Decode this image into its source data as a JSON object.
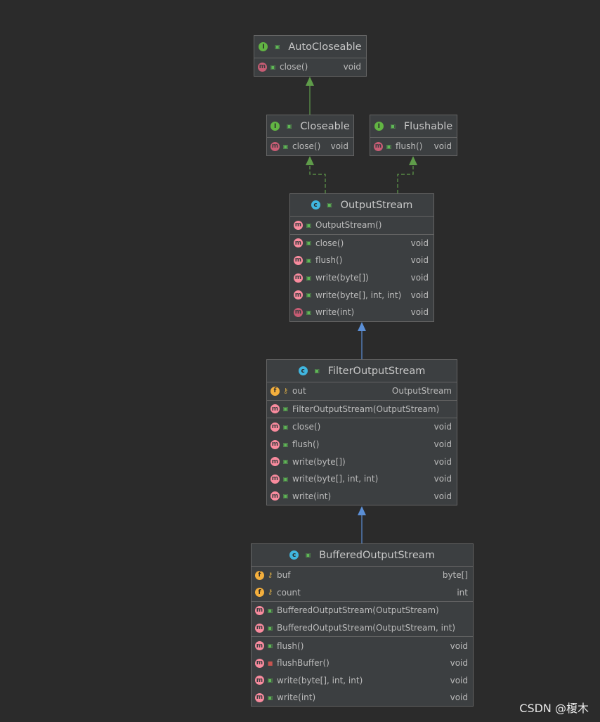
{
  "diagram": {
    "classes": {
      "auto_closeable": {
        "kind_icon": "interface-icon",
        "title": "AutoCloseable",
        "methods": [
          {
            "name": "close()",
            "type": "void",
            "abstract": true
          }
        ]
      },
      "closeable": {
        "kind_icon": "interface-icon",
        "title": "Closeable",
        "methods": [
          {
            "name": "close()",
            "type": "void",
            "abstract": true
          }
        ]
      },
      "flushable": {
        "kind_icon": "interface-icon",
        "title": "Flushable",
        "methods": [
          {
            "name": "flush()",
            "type": "void",
            "abstract": true
          }
        ]
      },
      "output_stream": {
        "kind_icon": "abstract-class-icon",
        "title": "OutputStream",
        "constructors": [
          {
            "name": "OutputStream()"
          }
        ],
        "methods": [
          {
            "name": "close()",
            "type": "void"
          },
          {
            "name": "flush()",
            "type": "void"
          },
          {
            "name": "write(byte[])",
            "type": "void"
          },
          {
            "name": "write(byte[], int, int)",
            "type": "void"
          },
          {
            "name": "write(int)",
            "type": "void",
            "abstract": true
          }
        ]
      },
      "filter_output_stream": {
        "kind_icon": "class-icon",
        "title": "FilterOutputStream",
        "fields": [
          {
            "name": "out",
            "type": "OutputStream",
            "visibility": "protected"
          }
        ],
        "constructors": [
          {
            "name": "FilterOutputStream(OutputStream)"
          }
        ],
        "methods": [
          {
            "name": "close()",
            "type": "void"
          },
          {
            "name": "flush()",
            "type": "void"
          },
          {
            "name": "write(byte[])",
            "type": "void"
          },
          {
            "name": "write(byte[], int, int)",
            "type": "void"
          },
          {
            "name": "write(int)",
            "type": "void"
          }
        ]
      },
      "buffered_output_stream": {
        "kind_icon": "class-icon",
        "title": "BufferedOutputStream",
        "fields": [
          {
            "name": "buf",
            "type": "byte[]",
            "visibility": "protected"
          },
          {
            "name": "count",
            "type": "int",
            "visibility": "protected"
          }
        ],
        "constructors": [
          {
            "name": "BufferedOutputStream(OutputStream)"
          },
          {
            "name": "BufferedOutputStream(OutputStream, int)"
          }
        ],
        "methods": [
          {
            "name": "flush()",
            "type": "void"
          },
          {
            "name": "flushBuffer()",
            "type": "void",
            "visibility": "private"
          },
          {
            "name": "write(byte[], int, int)",
            "type": "void"
          },
          {
            "name": "write(int)",
            "type": "void"
          }
        ]
      }
    },
    "relations": [
      {
        "from": "Closeable",
        "to": "AutoCloseable",
        "type": "extends"
      },
      {
        "from": "OutputStream",
        "to": "Closeable",
        "type": "implements"
      },
      {
        "from": "OutputStream",
        "to": "Flushable",
        "type": "implements"
      },
      {
        "from": "FilterOutputStream",
        "to": "OutputStream",
        "type": "extends"
      },
      {
        "from": "BufferedOutputStream",
        "to": "FilterOutputStream",
        "type": "extends"
      }
    ],
    "colors": {
      "interface_edge": "#5f9c4a",
      "class_edge": "#5b8fd6",
      "background": "#2b2b2b"
    }
  },
  "watermark": "CSDN @榎木"
}
